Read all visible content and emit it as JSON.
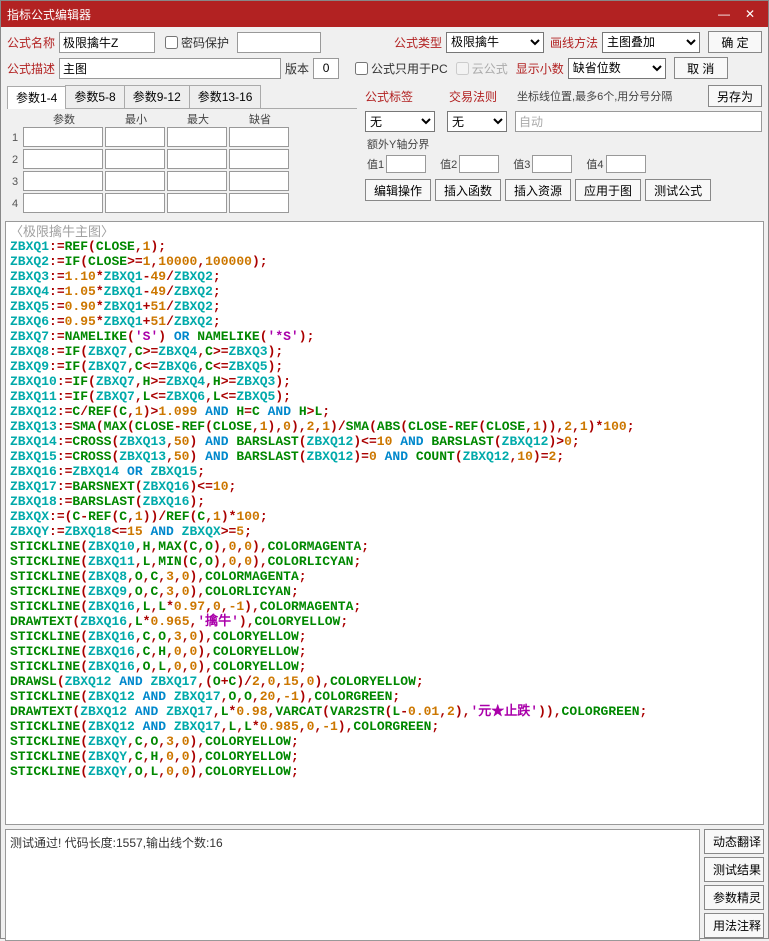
{
  "title": "指标公式编辑器",
  "labels": {
    "formula_name": "公式名称",
    "password": "密码保护",
    "formula_type": "公式类型",
    "line_method": "画线方法",
    "formula_desc": "公式描述",
    "version": "版本",
    "pc_only": "公式只用于PC",
    "cloud": "云公式",
    "decimals": "显示小数",
    "formula_tag": "公式标签",
    "trade_rule": "交易法则",
    "coord_hint": "坐标线位置,最多6个,用分号分隔",
    "extra_y": "额外Y轴分界",
    "v1": "值1",
    "v2": "值2",
    "v3": "值3",
    "v4": "值4",
    "param": "参数",
    "min": "最小",
    "max": "最大",
    "default": "缺省"
  },
  "fields": {
    "name": "极限擒牛Z",
    "desc": "主图",
    "version": "0",
    "type": "极限擒牛",
    "line_method": "主图叠加",
    "decimals": "缺省位数",
    "tag": "无",
    "rule": "无",
    "coord": "自动"
  },
  "param_tabs": [
    "参数1-4",
    "参数5-8",
    "参数9-12",
    "参数13-16"
  ],
  "buttons": {
    "ok": "确 定",
    "cancel": "取 消",
    "save_as": "另存为",
    "edit_op": "编辑操作",
    "insert_fn": "插入函数",
    "insert_res": "插入资源",
    "apply_chart": "应用于图",
    "test": "测试公式",
    "translate": "动态翻译",
    "test_result": "测试结果",
    "param_wiz": "参数精灵",
    "usage": "用法注释"
  },
  "row_nums": [
    "1",
    "2",
    "3",
    "4"
  ],
  "code_title": "〈极限擒牛主图〉",
  "code_lines": [
    [
      "ZBXQ1",
      ":=",
      "REF",
      "(",
      "CLOSE",
      ",",
      "1",
      ")",
      ";"
    ],
    [
      "ZBXQ2",
      ":=",
      "IF",
      "(",
      "CLOSE",
      ">=",
      "1",
      ",",
      "10000",
      ",",
      "100000",
      ")",
      ";"
    ],
    [
      "ZBXQ3",
      ":=",
      "1.10",
      "*",
      "ZBXQ1",
      "-",
      "49",
      "/",
      "ZBXQ2",
      ";"
    ],
    [
      "ZBXQ4",
      ":=",
      "1.05",
      "*",
      "ZBXQ1",
      "-",
      "49",
      "/",
      "ZBXQ2",
      ";"
    ],
    [
      "ZBXQ5",
      ":=",
      "0.90",
      "*",
      "ZBXQ1",
      "+",
      "51",
      "/",
      "ZBXQ2",
      ";"
    ],
    [
      "ZBXQ6",
      ":=",
      "0.95",
      "*",
      "ZBXQ1",
      "+",
      "51",
      "/",
      "ZBXQ2",
      ";"
    ],
    [
      "ZBXQ7",
      ":=",
      "NAMELIKE",
      "(",
      "'S'",
      ")",
      " OR ",
      "NAMELIKE",
      "(",
      "'*S'",
      ")",
      ";"
    ],
    [
      "ZBXQ8",
      ":=",
      "IF",
      "(",
      "ZBXQ7",
      ",",
      "C",
      ">=",
      "ZBXQ4",
      ",",
      "C",
      ">=",
      "ZBXQ3",
      ")",
      ";"
    ],
    [
      "ZBXQ9",
      ":=",
      "IF",
      "(",
      "ZBXQ7",
      ",",
      "C",
      "<=",
      "ZBXQ6",
      ",",
      "C",
      "<=",
      "ZBXQ5",
      ")",
      ";"
    ],
    [
      "ZBXQ10",
      ":=",
      "IF",
      "(",
      "ZBXQ7",
      ",",
      "H",
      ">=",
      "ZBXQ4",
      ",",
      "H",
      ">=",
      "ZBXQ3",
      ")",
      ";"
    ],
    [
      "ZBXQ11",
      ":=",
      "IF",
      "(",
      "ZBXQ7",
      ",",
      "L",
      "<=",
      "ZBXQ6",
      ",",
      "L",
      "<=",
      "ZBXQ5",
      ")",
      ";"
    ],
    [
      "ZBXQ12",
      ":=",
      "C",
      "/",
      "REF",
      "(",
      "C",
      ",",
      "1",
      ")",
      ">",
      "1.099",
      " AND ",
      "H",
      "=",
      "C",
      " AND ",
      "H",
      ">",
      "L",
      ";"
    ],
    [
      "ZBXQ13",
      ":=",
      "SMA",
      "(",
      "MAX",
      "(",
      "CLOSE",
      "-",
      "REF",
      "(",
      "CLOSE",
      ",",
      "1",
      ")",
      ",",
      "0",
      ")",
      ",",
      "2",
      ",",
      "1",
      ")",
      "/",
      "SMA",
      "(",
      "ABS",
      "(",
      "CLOSE",
      "-",
      "REF",
      "(",
      "CLOSE",
      ",",
      "1",
      ")",
      ")",
      ",",
      "2",
      ",",
      "1",
      ")",
      "*",
      "100",
      ";"
    ],
    [
      "ZBXQ14",
      ":=",
      "CROSS",
      "(",
      "ZBXQ13",
      ",",
      "50",
      ")",
      " AND ",
      "BARSLAST",
      "(",
      "ZBXQ12",
      ")",
      "<=",
      "10",
      " AND ",
      "BARSLAST",
      "(",
      "ZBXQ12",
      ")",
      ">",
      "0",
      ";"
    ],
    [
      "ZBXQ15",
      ":=",
      "CROSS",
      "(",
      "ZBXQ13",
      ",",
      "50",
      ")",
      " AND ",
      "BARSLAST",
      "(",
      "ZBXQ12",
      ")",
      "=",
      "0",
      " AND ",
      "COUNT",
      "(",
      "ZBXQ12",
      ",",
      "10",
      ")",
      "=",
      "2",
      ";"
    ],
    [
      "ZBXQ16",
      ":=",
      "ZBXQ14",
      " OR ",
      "ZBXQ15",
      ";"
    ],
    [
      "ZBXQ17",
      ":=",
      "BARSNEXT",
      "(",
      "ZBXQ16",
      ")",
      "<=",
      "10",
      ";"
    ],
    [
      "ZBXQ18",
      ":=",
      "BARSLAST",
      "(",
      "ZBXQ16",
      ")",
      ";"
    ],
    [
      "ZBXQX",
      ":=",
      "(",
      "C",
      "-",
      "REF",
      "(",
      "C",
      ",",
      "1",
      ")",
      ")",
      "/",
      "REF",
      "(",
      "C",
      ",",
      "1",
      ")",
      "*",
      "100",
      ";"
    ],
    [
      "ZBXQY",
      ":=",
      "ZBXQ18",
      "<=",
      "15",
      " AND ",
      "ZBXQX",
      ">=",
      "5",
      ";"
    ],
    [
      "STICKLINE",
      "(",
      "ZBXQ10",
      ",",
      "H",
      ",",
      "MAX",
      "(",
      "C",
      ",",
      "O",
      ")",
      ",",
      "0",
      ",",
      "0",
      ")",
      ",",
      "COLORMAGENTA",
      ";"
    ],
    [
      "STICKLINE",
      "(",
      "ZBXQ11",
      ",",
      "L",
      ",",
      "MIN",
      "(",
      "C",
      ",",
      "O",
      ")",
      ",",
      "0",
      ",",
      "0",
      ")",
      ",",
      "COLORLICYAN",
      ";"
    ],
    [
      "STICKLINE",
      "(",
      "ZBXQ8",
      ",",
      "O",
      ",",
      "C",
      ",",
      "3",
      ",",
      "0",
      ")",
      ",",
      "COLORMAGENTA",
      ";"
    ],
    [
      "STICKLINE",
      "(",
      "ZBXQ9",
      ",",
      "O",
      ",",
      "C",
      ",",
      "3",
      ",",
      "0",
      ")",
      ",",
      "COLORLICYAN",
      ";"
    ],
    [
      "STICKLINE",
      "(",
      "ZBXQ16",
      ",",
      "L",
      ",",
      "L",
      "*",
      "0.97",
      ",",
      "0",
      ",",
      "-1",
      ")",
      ",",
      "COLORMAGENTA",
      ";"
    ],
    [
      "DRAWTEXT",
      "(",
      "ZBXQ16",
      ",",
      "L",
      "*",
      "0.965",
      ",",
      "'擒牛'",
      ")",
      ",",
      "COLORYELLOW",
      ";"
    ],
    [
      "STICKLINE",
      "(",
      "ZBXQ16",
      ",",
      "C",
      ",",
      "O",
      ",",
      "3",
      ",",
      "0",
      ")",
      ",",
      "COLORYELLOW",
      ";"
    ],
    [
      "STICKLINE",
      "(",
      "ZBXQ16",
      ",",
      "C",
      ",",
      "H",
      ",",
      "0",
      ",",
      "0",
      ")",
      ",",
      "COLORYELLOW",
      ";"
    ],
    [
      "STICKLINE",
      "(",
      "ZBXQ16",
      ",",
      "O",
      ",",
      "L",
      ",",
      "0",
      ",",
      "0",
      ")",
      ",",
      "COLORYELLOW",
      ";"
    ],
    [
      "DRAWSL",
      "(",
      "ZBXQ12",
      " AND ",
      "ZBXQ17",
      ",",
      "(",
      "O",
      "+",
      "C",
      ")",
      "/",
      "2",
      ",",
      "0",
      ",",
      "15",
      ",",
      "0",
      ")",
      ",",
      "COLORYELLOW",
      ";"
    ],
    [
      "STICKLINE",
      "(",
      "ZBXQ12",
      " AND ",
      "ZBXQ17",
      ",",
      "O",
      ",",
      "O",
      ",",
      "20",
      ",",
      "-1",
      ")",
      ",",
      "COLORGREEN",
      ";"
    ],
    [
      "DRAWTEXT",
      "(",
      "ZBXQ12",
      " AND ",
      "ZBXQ17",
      ",",
      "L",
      "*",
      "0.98",
      ",",
      "VARCAT",
      "(",
      "VAR2STR",
      "(",
      "L",
      "-",
      "0.01",
      ",",
      "2",
      ")",
      ",",
      "'元★止跌'",
      ")",
      ")",
      ",",
      "COLORGREEN",
      ";"
    ],
    [
      "STICKLINE",
      "(",
      "ZBXQ12",
      " AND ",
      "ZBXQ17",
      ",",
      "L",
      ",",
      "L",
      "*",
      "0.985",
      ",",
      "0",
      ",",
      "-1",
      ")",
      ",",
      "COLORGREEN",
      ";"
    ],
    [
      "STICKLINE",
      "(",
      "ZBXQY",
      ",",
      "C",
      ",",
      "O",
      ",",
      "3",
      ",",
      "0",
      ")",
      ",",
      "COLORYELLOW",
      ";"
    ],
    [
      "STICKLINE",
      "(",
      "ZBXQY",
      ",",
      "C",
      ",",
      "H",
      ",",
      "0",
      ",",
      "0",
      ")",
      ",",
      "COLORYELLOW",
      ";"
    ],
    [
      "STICKLINE",
      "(",
      "ZBXQY",
      ",",
      "O",
      ",",
      "L",
      ",",
      "0",
      ",",
      "0",
      ")",
      ",",
      "COLORYELLOW",
      ";"
    ]
  ],
  "status": "测试通过! 代码长度:1557,输出线个数:16"
}
